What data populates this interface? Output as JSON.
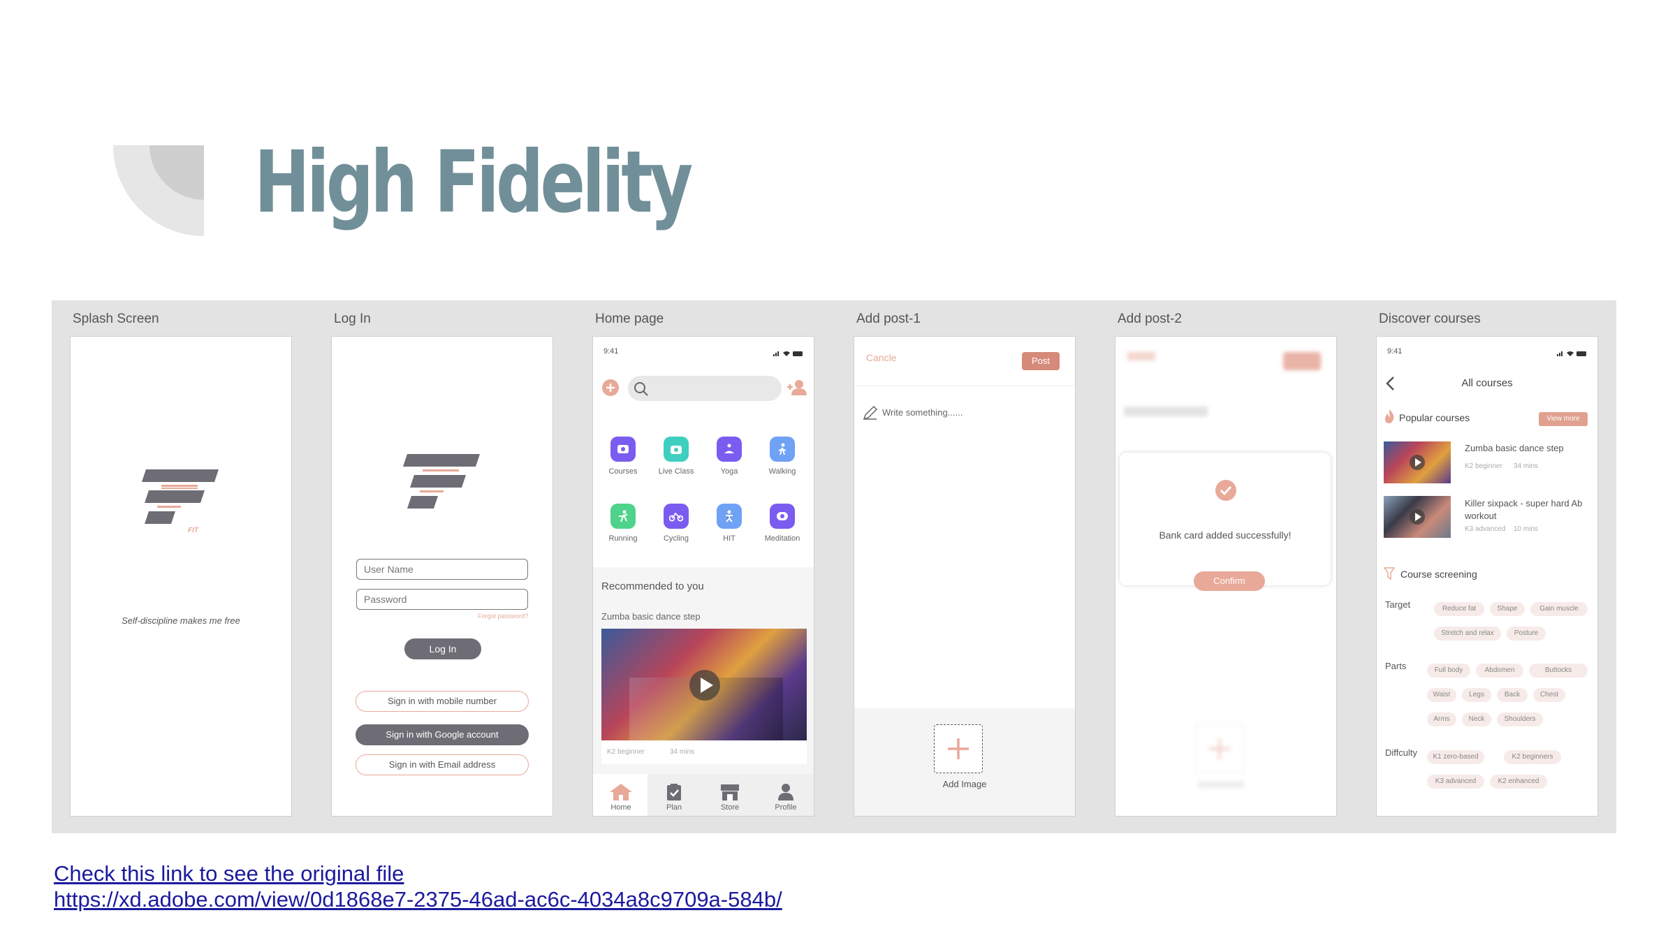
{
  "slide": {
    "title": "High Fidelity"
  },
  "screens": [
    {
      "label": "Splash Screen",
      "logo_text": "FIT",
      "tagline": "Self-discipline makes me free"
    },
    {
      "label": "Log In",
      "username_placeholder": "User Name",
      "password_placeholder": "Password",
      "forgot": "Forgot password?",
      "login_button": "Log In",
      "mobile_button": "Sign in with mobile number",
      "google_button": "Sign in with Google account",
      "email_button": "Sign in with Email address"
    },
    {
      "label": "Home page",
      "time": "9:41",
      "categories": [
        "Courses",
        "Live Class",
        "Yoga",
        "Walking",
        "Running",
        "Cycling",
        "HIT",
        "Meditation"
      ],
      "recommended": "Recommended to you",
      "video_title": "Zumba basic dance step",
      "video_level": "K2 beginner",
      "video_duration": "34 mins",
      "tabs": [
        "Home",
        "Plan",
        "Store",
        "Profile"
      ]
    },
    {
      "label": "Add post-1",
      "cancel": "Cancle",
      "post": "Post",
      "write": "Write something......",
      "add_image": "Add Image"
    },
    {
      "label": "Add post-2",
      "dialog_message": "Bank card added successfully!",
      "confirm": "Confirm"
    },
    {
      "label": "Discover courses",
      "time": "9:41",
      "header": "All courses",
      "popular": "Popular courses",
      "view_more": "View more",
      "courses": [
        {
          "title": "Zumba basic dance step",
          "level": "K2 beginner",
          "duration": "34 mins"
        },
        {
          "title": "Killer sixpack - super hard Ab workout",
          "level": "K3 advanced",
          "duration": "10 mins"
        }
      ],
      "screening": "Course screening",
      "target_label": "Target",
      "target_chips": [
        "Reduce fat",
        "Shape",
        "Gain muscle",
        "Stretch and relax",
        "Posture"
      ],
      "parts_label": "Parts",
      "parts_chips": [
        "Full body",
        "Abdomen",
        "Buttocks",
        "Waist",
        "Legs",
        "Back",
        "Chest",
        "Arms",
        "Neck",
        "Shoulders"
      ],
      "difficulty_label": "Diffculty",
      "difficulty_chips": [
        "K1 zero-based",
        "K2 beginners",
        "K3 advanced",
        "K2 enhanced"
      ]
    }
  ],
  "links": {
    "text": "Check this link to see the original file",
    "url": "https://xd.adobe.com/view/0d1868e7-2375-46ad-ac6c-4034a8c9709a-584b/"
  },
  "colors": {
    "title": "#718f99",
    "accent": "#e8a999",
    "dark_button": "#6e6c74",
    "link": "#1b1a9e"
  }
}
